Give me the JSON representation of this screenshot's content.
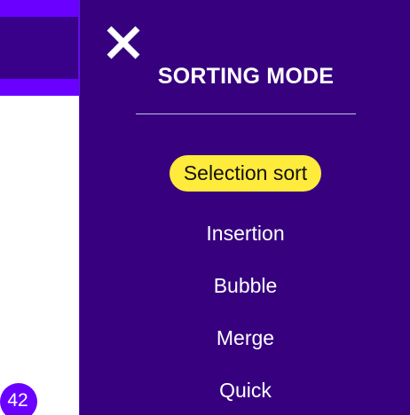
{
  "badge": {
    "value": "42"
  },
  "drawer": {
    "title": "SORTING MODE",
    "close_icon": "close-icon",
    "selected": "Selection sort",
    "options": [
      {
        "label": "Selection sort"
      },
      {
        "label": "Insertion"
      },
      {
        "label": "Bubble"
      },
      {
        "label": "Merge"
      },
      {
        "label": "Quick"
      }
    ]
  },
  "colors": {
    "panel": "#36007f",
    "accent": "#6a00ff",
    "selected_bg": "#ffeb3b"
  }
}
